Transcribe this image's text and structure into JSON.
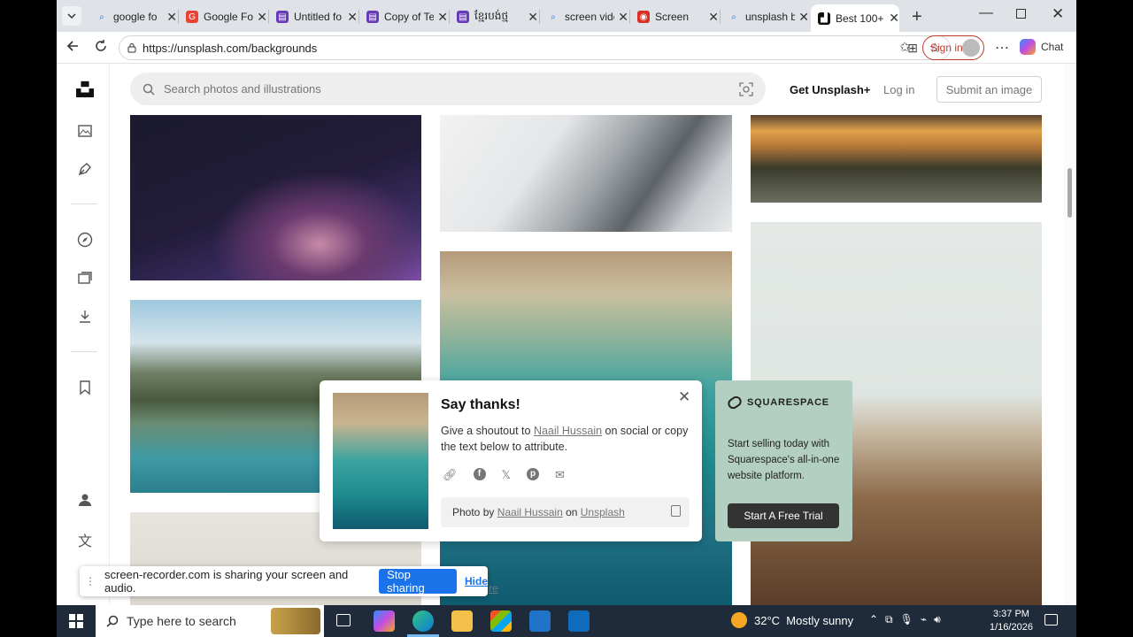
{
  "browser": {
    "tabs": [
      {
        "label": "google fo",
        "icon": "search-icon"
      },
      {
        "label": "Google Fo",
        "icon": "google-icon"
      },
      {
        "label": "Untitled fo",
        "icon": "forms-icon"
      },
      {
        "label": "Copy of Te",
        "icon": "forms-icon"
      },
      {
        "label": "ខ្មែរបង់ថ្ម",
        "icon": "forms-icon"
      },
      {
        "label": "screen vide",
        "icon": "search-icon"
      },
      {
        "label": "Screen",
        "icon": "record-icon"
      },
      {
        "label": "unsplash b",
        "icon": "search-icon"
      },
      {
        "label": "Best 100+",
        "icon": "unsplash-icon"
      }
    ],
    "url": "https://unsplash.com/backgrounds",
    "sign_in": "Sign in",
    "chat": "Chat"
  },
  "header": {
    "search_placeholder": "Search photos and illustrations",
    "get_plus": "Get Unsplash+",
    "login": "Log in",
    "submit": "Submit an image"
  },
  "thanks_popup": {
    "title": "Say thanks!",
    "text_before": "Give a shoutout to ",
    "author": "Naail Hussain",
    "text_after": " on social or copy the text below to attribute.",
    "credit_prefix": "Photo by ",
    "credit_author": "Naail Hussain",
    "credit_on": " on ",
    "credit_site": "Unsplash"
  },
  "ad": {
    "brand": "SQUARESPACE",
    "text": "Start selling today with Squarespace's all-in-one website platform.",
    "cta": "Start A Free Trial"
  },
  "share_bar": {
    "message": "screen-recorder.com is sharing your screen and audio.",
    "stop": "Stop sharing",
    "hide": "Hide",
    "behind_text": "re"
  },
  "taskbar": {
    "search_placeholder": "Type here to search",
    "weather": "32°C  Mostly sunny",
    "time": "3:37 PM",
    "date": "1/16/2026"
  }
}
